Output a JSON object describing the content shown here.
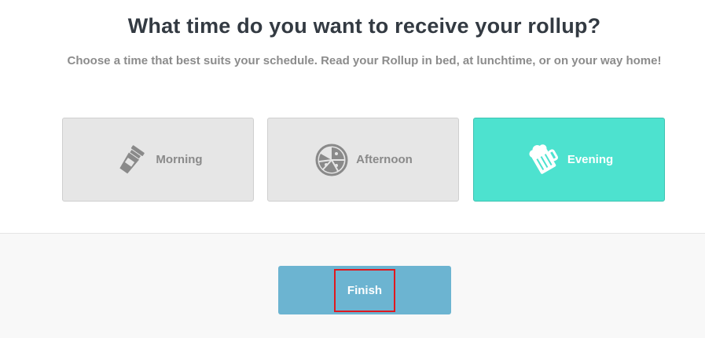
{
  "header": {
    "title": "What time do you want to receive your rollup?",
    "subtitle": "Choose a time that best suits your schedule. Read your Rollup in bed, at lunchtime, or on your way home!"
  },
  "options": [
    {
      "label": "Morning",
      "icon": "coffee-cup-icon",
      "selected": false
    },
    {
      "label": "Afternoon",
      "icon": "pizza-icon",
      "selected": false
    },
    {
      "label": "Evening",
      "icon": "beer-mug-icon",
      "selected": true
    }
  ],
  "footer": {
    "finish_label": "Finish"
  },
  "colors": {
    "selected_option": "#4de2cf",
    "unselected_option": "#e6e6e6",
    "finish_button": "#6cb4d1",
    "highlight_box": "#e0191f",
    "title_text": "#333a42"
  }
}
